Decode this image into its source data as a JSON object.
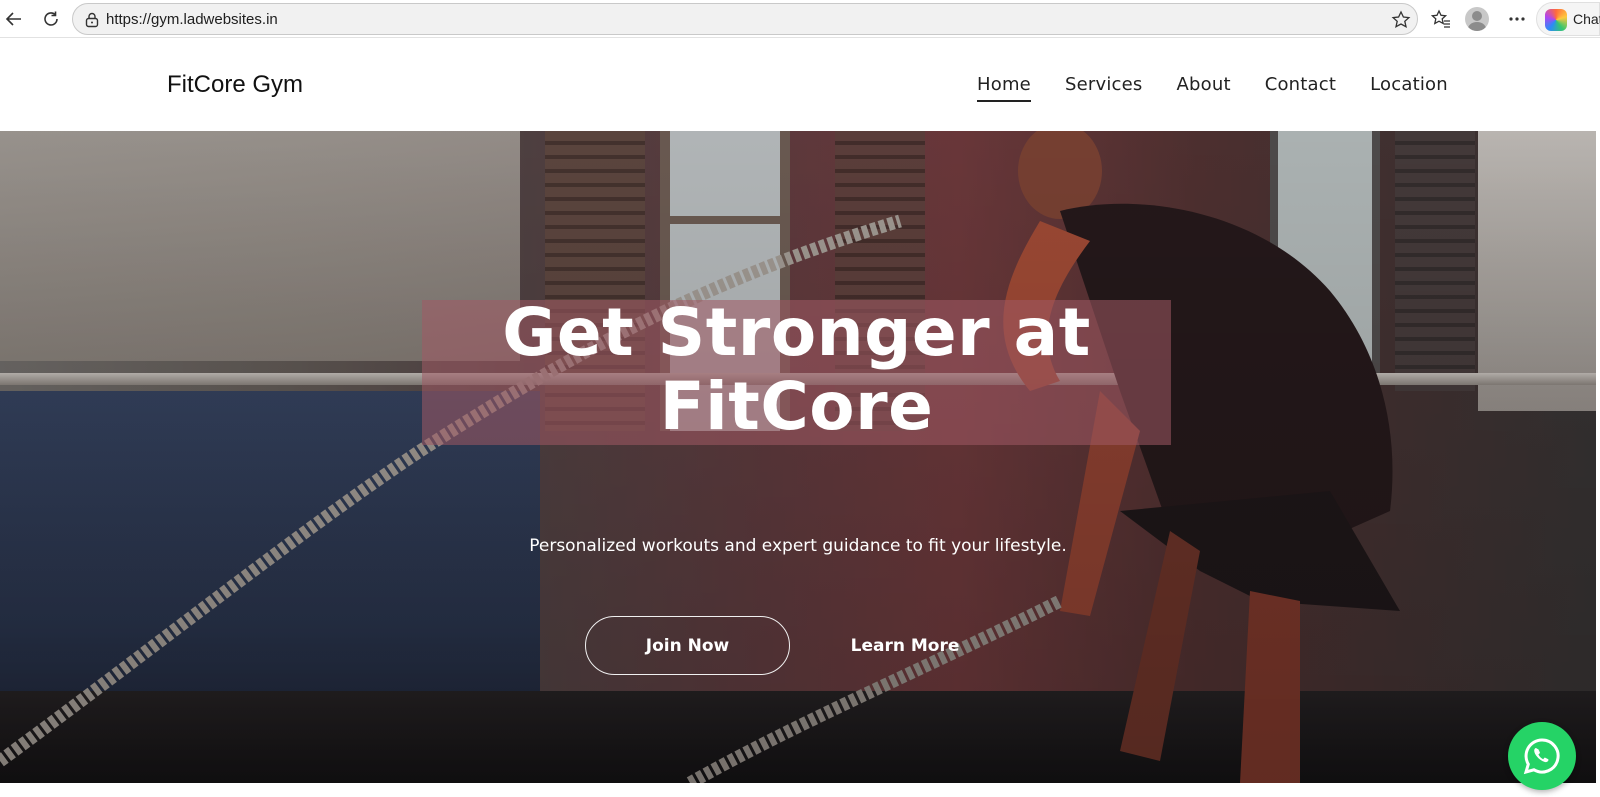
{
  "browser": {
    "url": "https://gym.ladwebsites.in",
    "copilot_label": "Chat"
  },
  "site": {
    "logo": "FitCore Gym",
    "nav": [
      {
        "label": "Home",
        "active": true
      },
      {
        "label": "Services",
        "active": false
      },
      {
        "label": "About",
        "active": false
      },
      {
        "label": "Contact",
        "active": false
      },
      {
        "label": "Location",
        "active": false
      }
    ]
  },
  "hero": {
    "headline_line1": "Get Stronger at",
    "headline_line2": "FitCore",
    "subtitle": "Personalized workouts and expert guidance to fit your lifestyle.",
    "primary_button": "Join Now",
    "secondary_button": "Learn More"
  },
  "colors": {
    "whatsapp": "#25d366",
    "headline_overlay": "#a05a64"
  },
  "icons": [
    "back-icon",
    "reload-icon",
    "lock-icon",
    "star-icon",
    "favorites-icon",
    "profile-icon",
    "more-icon",
    "copilot-icon",
    "whatsapp-icon"
  ]
}
